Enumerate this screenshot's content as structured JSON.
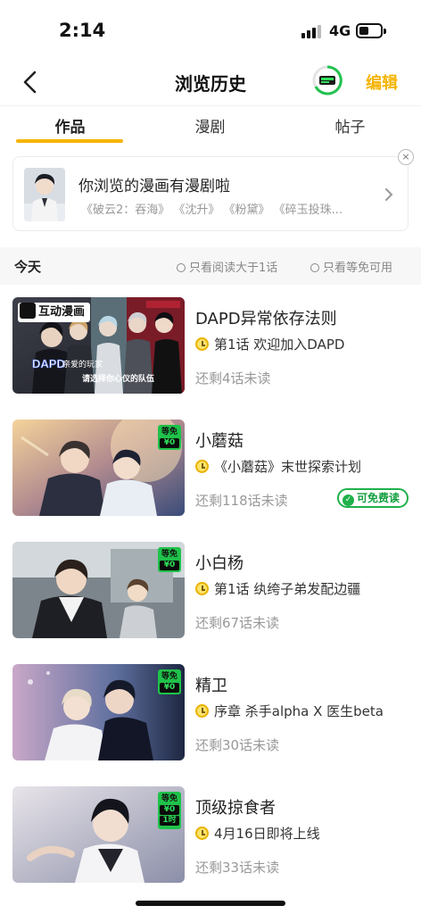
{
  "status_bar": {
    "time": "2:14",
    "network": "4G"
  },
  "header": {
    "title": "浏览历史",
    "edit_label": "编辑",
    "back_icon": "chevron-left-icon",
    "badge_icon": "reading-progress-icon"
  },
  "tabs": [
    {
      "label": "作品",
      "active": true
    },
    {
      "label": "漫剧",
      "active": false
    },
    {
      "label": "帖子",
      "active": false
    }
  ],
  "banner": {
    "title": "你浏览的漫画有漫剧啦",
    "subtitle": "《破云2：吞海》 《沈升》 《粉黛》 《碎玉投珠...",
    "close_symbol": "×"
  },
  "filter": {
    "day": "今天",
    "option1": "只看阅读大于1话",
    "option2": "只看等免可用"
  },
  "items": [
    {
      "title": "DAPD异常依存法则",
      "episode": "第1话 欢迎加入DAPD",
      "remaining": "还剩4话未读",
      "tag": "互动漫画",
      "cover_text1": "亲爱的玩家",
      "cover_text2": "请选择你心仪的队伍",
      "cover_logo": "DAPD"
    },
    {
      "title": "小蘑菇",
      "episode": "《小蘑菇》末世探索计划",
      "remaining": "还剩118话未读",
      "free_wait": "等免",
      "price": "¥0",
      "free_read": "可免费读"
    },
    {
      "title": "小白杨",
      "episode": "第1话 纨绔子弟发配边疆",
      "remaining": "还剩67话未读",
      "free_wait": "等免",
      "price": "¥0"
    },
    {
      "title": "精卫",
      "episode": "序章 杀手alpha X 医生beta",
      "remaining": "还剩30话未读",
      "free_wait": "等免",
      "price": "¥0"
    },
    {
      "title": "顶级掠食者",
      "episode": "4月16日即将上线",
      "remaining": "还剩33话未读",
      "free_wait": "等免",
      "price": "¥0",
      "extra": "1时"
    }
  ],
  "colors": {
    "accent": "#f5b400",
    "free_green": "#1fb14a"
  }
}
